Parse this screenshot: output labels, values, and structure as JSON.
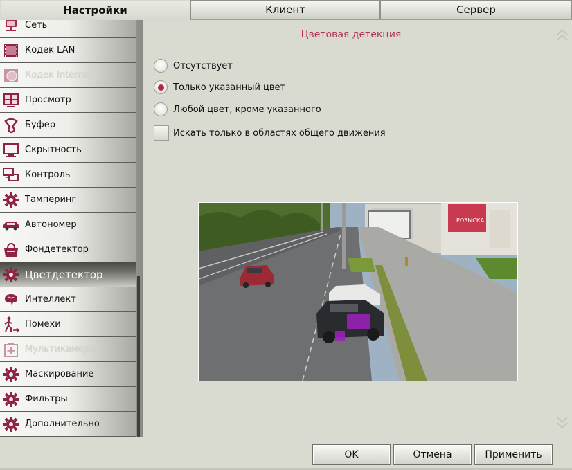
{
  "tabs": [
    {
      "label": "Настройки",
      "active": true
    },
    {
      "label": "Клиент",
      "active": false
    },
    {
      "label": "Сервер",
      "active": false
    }
  ],
  "sidebar": {
    "items": [
      {
        "label": "Сеть",
        "icon": "network-icon",
        "state": "normal"
      },
      {
        "label": "Кодек LAN",
        "icon": "film-icon",
        "state": "normal"
      },
      {
        "label": "Кодек Internet",
        "icon": "globe-icon",
        "state": "disabled"
      },
      {
        "label": "Просмотр",
        "icon": "monitor-grid-icon",
        "state": "normal"
      },
      {
        "label": "Буфер",
        "icon": "buffer-icon",
        "state": "normal"
      },
      {
        "label": "Скрытность",
        "icon": "screen-icon",
        "state": "normal"
      },
      {
        "label": "Контроль",
        "icon": "control-icon",
        "state": "normal"
      },
      {
        "label": "Тамперинг",
        "icon": "gear-icon",
        "state": "normal"
      },
      {
        "label": "Автономер",
        "icon": "car-icon",
        "state": "normal"
      },
      {
        "label": "Фондетектор",
        "icon": "bag-icon",
        "state": "normal"
      },
      {
        "label": "Цветдетектор",
        "icon": "gear-icon",
        "state": "selected"
      },
      {
        "label": "Интеллект",
        "icon": "brain-icon",
        "state": "normal"
      },
      {
        "label": "Помехи",
        "icon": "walker-icon",
        "state": "normal"
      },
      {
        "label": "Мультикамеры",
        "icon": "plus-box-icon",
        "state": "disabled"
      },
      {
        "label": "Маскирование",
        "icon": "gear-icon",
        "state": "normal"
      },
      {
        "label": "Фильтры",
        "icon": "gear-icon",
        "state": "normal"
      },
      {
        "label": "Дополнительно",
        "icon": "gear-icon",
        "state": "normal"
      }
    ]
  },
  "panel": {
    "title": "Цветовая детекция",
    "options": [
      {
        "label": "Отсутствует",
        "selected": false
      },
      {
        "label": "Только указанный цвет",
        "selected": true
      },
      {
        "label": "Любой цвет, кроме указанного",
        "selected": false
      }
    ],
    "motion_only": {
      "label": "Искать только в областях общего движения",
      "checked": false
    },
    "billboard_text": "РОЗЫСКА"
  },
  "buttons": {
    "ok": "OK",
    "cancel": "Отмена",
    "apply": "Применить"
  },
  "colors": {
    "accent": "#b3244a",
    "title": "#b2344f",
    "detect_overlay": "#a020c0"
  }
}
